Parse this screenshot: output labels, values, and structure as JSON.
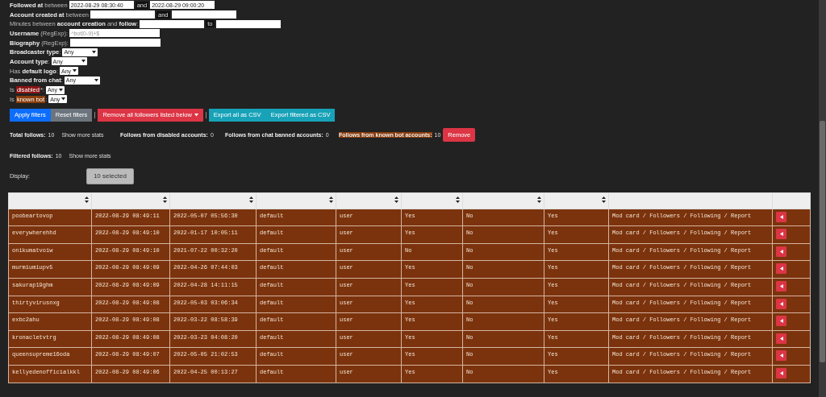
{
  "filters": [
    {
      "kind": "range",
      "label": "**Followed at** between",
      "from_value": "2022-08-29 08:30:40",
      "separator": "and",
      "to_value": "2022-08-29 09:00:20"
    },
    {
      "kind": "range",
      "label": "**Account created at** between",
      "separator": "and"
    },
    {
      "kind": "range",
      "label": "Minutes between **account creation** and **follow**:",
      "separator": "to"
    },
    {
      "kind": "text",
      "label": "**Username** (RegExp):",
      "placeholder": "^bot[0-9]+$"
    },
    {
      "kind": "text",
      "label": "**Biography** (RegExp):"
    },
    {
      "kind": "select",
      "label": "**Broadcaster type**:",
      "value": "Any"
    },
    {
      "kind": "select",
      "label": "**Account type**:",
      "value": "Any"
    },
    {
      "kind": "select",
      "label": "Has **default logo**:",
      "value": "Any"
    },
    {
      "kind": "select",
      "label": "**Banned from chat**:",
      "value": "Any"
    },
    {
      "kind": "select",
      "prefix": "Is",
      "highlight": "disabled",
      "color": "#8b1414",
      "suffix": "*:",
      "value": "Any"
    },
    {
      "kind": "select",
      "prefix": "Is",
      "highlight": "known bot",
      "color": "#8a3d0c",
      "suffix": ":",
      "value": "Any"
    }
  ],
  "toolbar": [
    {
      "label": "Apply filters",
      "color": "#0d6efd"
    },
    {
      "label": "Reset filters",
      "color": "#6c757d"
    },
    {
      "label": "Remove all followers listed below",
      "color": "#dc3545",
      "dropdown": true,
      "divider_before": true
    },
    {
      "label": "Export all as CSV",
      "color": "#17a2b8",
      "divider_before": true
    },
    {
      "label": "Export filtered as CSV",
      "color": "#17a2b8"
    }
  ],
  "stats": [
    {
      "label": "Total follows:",
      "value": "10",
      "link": "Show more stats"
    },
    {
      "label": "Follows from disabled accounts:",
      "value": "0"
    },
    {
      "label": "Follows from chat banned accounts:",
      "value": "0"
    },
    {
      "label": "Follows from known bot accounts:",
      "value": "10",
      "color": "#8a3d0c",
      "button": "Remove"
    }
  ],
  "filtered_stats": {
    "label": "Filtered follows:",
    "value": "10",
    "link": "Show more stats"
  },
  "display": {
    "label": "Display:",
    "button": "10 selected"
  },
  "table": {
    "columns": [
      {
        "sortable": true
      },
      {
        "sortable": true
      },
      {
        "sortable": true
      },
      {
        "sortable": true
      },
      {
        "sortable": true
      },
      {
        "sortable": true
      },
      {
        "sortable": true
      },
      {
        "sortable": true
      },
      {
        "sortable": false
      },
      {
        "sortable": false
      }
    ],
    "rows": [
      [
        "poobeartovop",
        "2022-08-29 08:49:11",
        "2022-05-07 05:56:30",
        "default",
        "user",
        "Yes",
        "No",
        "Yes",
        "Mod card / Followers / Following / Report"
      ],
      [
        "everywherehhd",
        "2022-08-29 08:49:10",
        "2022-01-17 10:05:11",
        "default",
        "user",
        "Yes",
        "No",
        "Yes",
        "Mod card / Followers / Following / Report"
      ],
      [
        "onikumatvoiw",
        "2022-08-29 08:49:10",
        "2021-07-22 00:32:20",
        "default",
        "user",
        "No",
        "No",
        "Yes",
        "Mod card / Followers / Following / Report"
      ],
      [
        "murmiumiupv5",
        "2022-08-29 08:49:09",
        "2022-04-26 07:44:03",
        "default",
        "user",
        "Yes",
        "No",
        "Yes",
        "Mod card / Followers / Following / Report"
      ],
      [
        "sakurap19ghm",
        "2022-08-29 08:49:09",
        "2022-04-28 14:11:15",
        "default",
        "user",
        "Yes",
        "No",
        "Yes",
        "Mod card / Followers / Following / Report"
      ],
      [
        "thirtyvirusnxg",
        "2022-08-29 08:49:08",
        "2022-05-03 03:06:34",
        "default",
        "user",
        "Yes",
        "No",
        "Yes",
        "Mod card / Followers / Following / Report"
      ],
      [
        "exbc2ahu",
        "2022-08-29 08:49:08",
        "2022-03-22 08:58:39",
        "default",
        "user",
        "Yes",
        "No",
        "Yes",
        "Mod card / Followers / Following / Report"
      ],
      [
        "kronacletvtrg",
        "2022-08-29 08:49:08",
        "2022-03-23 04:08:20",
        "default",
        "user",
        "Yes",
        "No",
        "Yes",
        "Mod card / Followers / Following / Report"
      ],
      [
        "queensupreme16oda",
        "2022-08-29 08:49:07",
        "2022-05-05 21:02:53",
        "default",
        "user",
        "Yes",
        "No",
        "Yes",
        "Mod card / Followers / Following / Report"
      ],
      [
        "kellyedenofficialkkl",
        "2022-08-29 08:49:06",
        "2022-04-25 00:13:27",
        "default",
        "user",
        "Yes",
        "No",
        "Yes",
        "Mod card / Followers / Following / Report"
      ]
    ]
  }
}
